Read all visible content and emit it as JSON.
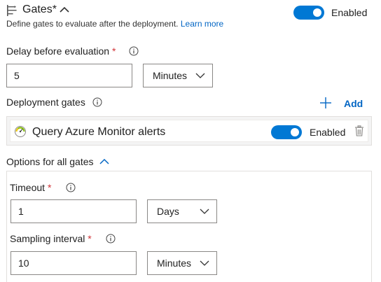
{
  "header": {
    "title": "Gates*",
    "icon": "gates-icon",
    "subtitle": "Define gates to evaluate after the deployment.",
    "learn_more": "Learn more",
    "toggle_label": "Enabled",
    "toggle_on": true
  },
  "delay": {
    "label": "Delay before evaluation",
    "required_mark": "*",
    "value": "5",
    "unit": "Minutes"
  },
  "deployment_gates": {
    "label": "Deployment gates",
    "add_label": "Add",
    "gates": [
      {
        "name": "Query Azure Monitor alerts",
        "icon": "azure-monitor-icon",
        "toggle_label": "Enabled",
        "enabled": true
      }
    ]
  },
  "options": {
    "label": "Options for all gates",
    "timeout": {
      "label": "Timeout",
      "required_mark": "*",
      "value": "1",
      "unit": "Days"
    },
    "sampling": {
      "label": "Sampling interval",
      "required_mark": "*",
      "value": "10",
      "unit": "Minutes"
    }
  },
  "colors": {
    "accent": "#0078d4",
    "link": "#0366c4",
    "required": "#d13438"
  }
}
